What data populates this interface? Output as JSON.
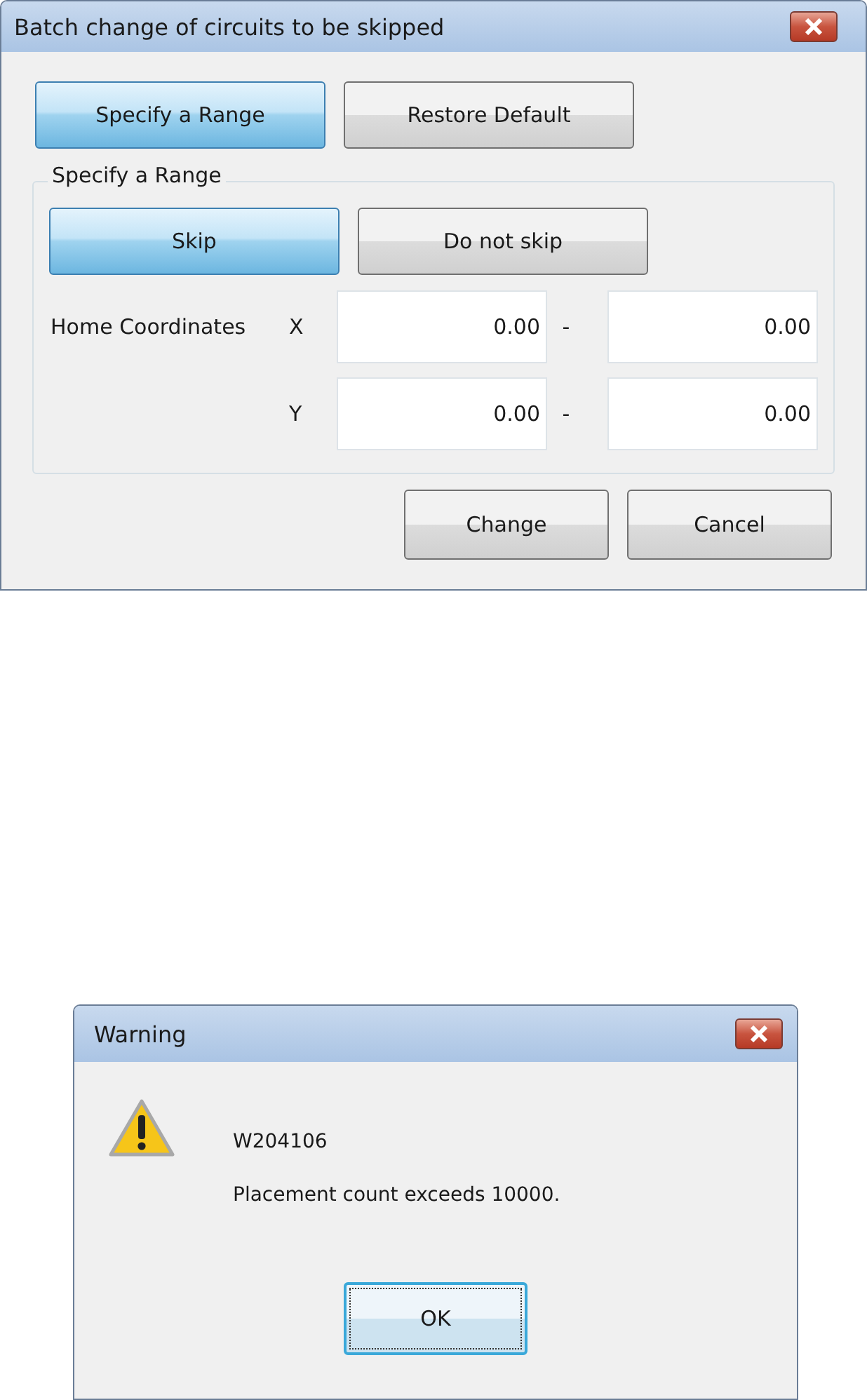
{
  "batch_dialog": {
    "title": "Batch change of circuits to be skipped",
    "mode_buttons": [
      {
        "label": "Specify a Range",
        "selected": true
      },
      {
        "label": "Restore Default",
        "selected": false
      }
    ],
    "range_group": {
      "legend": "Specify a Range",
      "skip_buttons": [
        {
          "label": "Skip",
          "selected": true
        },
        {
          "label": "Do not skip",
          "selected": false
        }
      ],
      "coordinates_label": "Home Coordinates",
      "rows": [
        {
          "axis": "X",
          "from": "0.00",
          "separator": "-",
          "to": "0.00"
        },
        {
          "axis": "Y",
          "from": "0.00",
          "separator": "-",
          "to": "0.00"
        }
      ]
    },
    "buttons": [
      {
        "label": "Change"
      },
      {
        "label": "Cancel"
      }
    ]
  },
  "warning_dialog": {
    "title": "Warning",
    "code": "W204106",
    "message": "Placement count exceeds 10000.",
    "buttons": [
      {
        "label": "OK",
        "focused": true
      }
    ]
  }
}
